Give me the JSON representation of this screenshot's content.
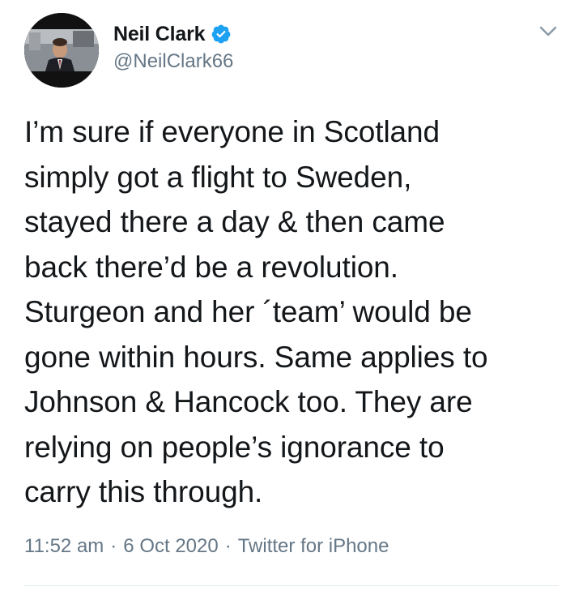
{
  "author": {
    "display_name": "Neil Clark",
    "handle": "@NeilClark66",
    "verified": true,
    "avatar_icon": "profile-photo",
    "verified_icon": "verified-badge-icon",
    "verified_color": "#1da1f2"
  },
  "tweet": {
    "text": "I’m sure if everyone in Scotland\nsimply got a flight to Sweden,\nstayed there a day & then came\nback there’d be a revolution.\nSturgeon and her ´team’ would be\ngone within hours. Same applies to\nJohnson & Hancock too. They are\nrelying on people’s ignorance to\ncarry this through.",
    "time": "11:52 am",
    "date": "6 Oct 2020",
    "source": "Twitter for iPhone",
    "separator": "·"
  },
  "menu": {
    "icon": "chevron-down-icon"
  },
  "colors": {
    "text": "#14171a",
    "muted": "#657786",
    "divider": "#e1e8ed",
    "accent": "#1da1f2"
  }
}
